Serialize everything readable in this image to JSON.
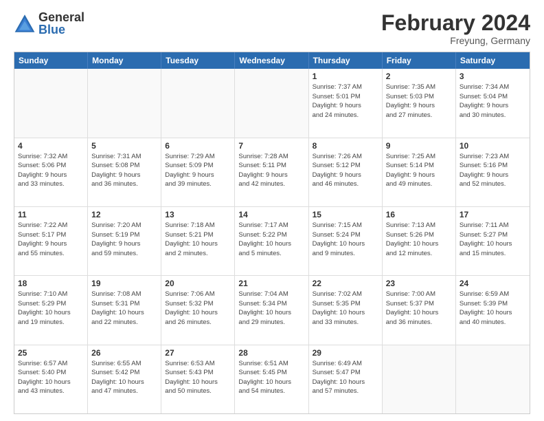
{
  "logo": {
    "general": "General",
    "blue": "Blue"
  },
  "title": "February 2024",
  "location": "Freyung, Germany",
  "header_days": [
    "Sunday",
    "Monday",
    "Tuesday",
    "Wednesday",
    "Thursday",
    "Friday",
    "Saturday"
  ],
  "weeks": [
    [
      {
        "day": "",
        "text": ""
      },
      {
        "day": "",
        "text": ""
      },
      {
        "day": "",
        "text": ""
      },
      {
        "day": "",
        "text": ""
      },
      {
        "day": "1",
        "text": "Sunrise: 7:37 AM\nSunset: 5:01 PM\nDaylight: 9 hours\nand 24 minutes."
      },
      {
        "day": "2",
        "text": "Sunrise: 7:35 AM\nSunset: 5:03 PM\nDaylight: 9 hours\nand 27 minutes."
      },
      {
        "day": "3",
        "text": "Sunrise: 7:34 AM\nSunset: 5:04 PM\nDaylight: 9 hours\nand 30 minutes."
      }
    ],
    [
      {
        "day": "4",
        "text": "Sunrise: 7:32 AM\nSunset: 5:06 PM\nDaylight: 9 hours\nand 33 minutes."
      },
      {
        "day": "5",
        "text": "Sunrise: 7:31 AM\nSunset: 5:08 PM\nDaylight: 9 hours\nand 36 minutes."
      },
      {
        "day": "6",
        "text": "Sunrise: 7:29 AM\nSunset: 5:09 PM\nDaylight: 9 hours\nand 39 minutes."
      },
      {
        "day": "7",
        "text": "Sunrise: 7:28 AM\nSunset: 5:11 PM\nDaylight: 9 hours\nand 42 minutes."
      },
      {
        "day": "8",
        "text": "Sunrise: 7:26 AM\nSunset: 5:12 PM\nDaylight: 9 hours\nand 46 minutes."
      },
      {
        "day": "9",
        "text": "Sunrise: 7:25 AM\nSunset: 5:14 PM\nDaylight: 9 hours\nand 49 minutes."
      },
      {
        "day": "10",
        "text": "Sunrise: 7:23 AM\nSunset: 5:16 PM\nDaylight: 9 hours\nand 52 minutes."
      }
    ],
    [
      {
        "day": "11",
        "text": "Sunrise: 7:22 AM\nSunset: 5:17 PM\nDaylight: 9 hours\nand 55 minutes."
      },
      {
        "day": "12",
        "text": "Sunrise: 7:20 AM\nSunset: 5:19 PM\nDaylight: 9 hours\nand 59 minutes."
      },
      {
        "day": "13",
        "text": "Sunrise: 7:18 AM\nSunset: 5:21 PM\nDaylight: 10 hours\nand 2 minutes."
      },
      {
        "day": "14",
        "text": "Sunrise: 7:17 AM\nSunset: 5:22 PM\nDaylight: 10 hours\nand 5 minutes."
      },
      {
        "day": "15",
        "text": "Sunrise: 7:15 AM\nSunset: 5:24 PM\nDaylight: 10 hours\nand 9 minutes."
      },
      {
        "day": "16",
        "text": "Sunrise: 7:13 AM\nSunset: 5:26 PM\nDaylight: 10 hours\nand 12 minutes."
      },
      {
        "day": "17",
        "text": "Sunrise: 7:11 AM\nSunset: 5:27 PM\nDaylight: 10 hours\nand 15 minutes."
      }
    ],
    [
      {
        "day": "18",
        "text": "Sunrise: 7:10 AM\nSunset: 5:29 PM\nDaylight: 10 hours\nand 19 minutes."
      },
      {
        "day": "19",
        "text": "Sunrise: 7:08 AM\nSunset: 5:31 PM\nDaylight: 10 hours\nand 22 minutes."
      },
      {
        "day": "20",
        "text": "Sunrise: 7:06 AM\nSunset: 5:32 PM\nDaylight: 10 hours\nand 26 minutes."
      },
      {
        "day": "21",
        "text": "Sunrise: 7:04 AM\nSunset: 5:34 PM\nDaylight: 10 hours\nand 29 minutes."
      },
      {
        "day": "22",
        "text": "Sunrise: 7:02 AM\nSunset: 5:35 PM\nDaylight: 10 hours\nand 33 minutes."
      },
      {
        "day": "23",
        "text": "Sunrise: 7:00 AM\nSunset: 5:37 PM\nDaylight: 10 hours\nand 36 minutes."
      },
      {
        "day": "24",
        "text": "Sunrise: 6:59 AM\nSunset: 5:39 PM\nDaylight: 10 hours\nand 40 minutes."
      }
    ],
    [
      {
        "day": "25",
        "text": "Sunrise: 6:57 AM\nSunset: 5:40 PM\nDaylight: 10 hours\nand 43 minutes."
      },
      {
        "day": "26",
        "text": "Sunrise: 6:55 AM\nSunset: 5:42 PM\nDaylight: 10 hours\nand 47 minutes."
      },
      {
        "day": "27",
        "text": "Sunrise: 6:53 AM\nSunset: 5:43 PM\nDaylight: 10 hours\nand 50 minutes."
      },
      {
        "day": "28",
        "text": "Sunrise: 6:51 AM\nSunset: 5:45 PM\nDaylight: 10 hours\nand 54 minutes."
      },
      {
        "day": "29",
        "text": "Sunrise: 6:49 AM\nSunset: 5:47 PM\nDaylight: 10 hours\nand 57 minutes."
      },
      {
        "day": "",
        "text": ""
      },
      {
        "day": "",
        "text": ""
      }
    ]
  ]
}
